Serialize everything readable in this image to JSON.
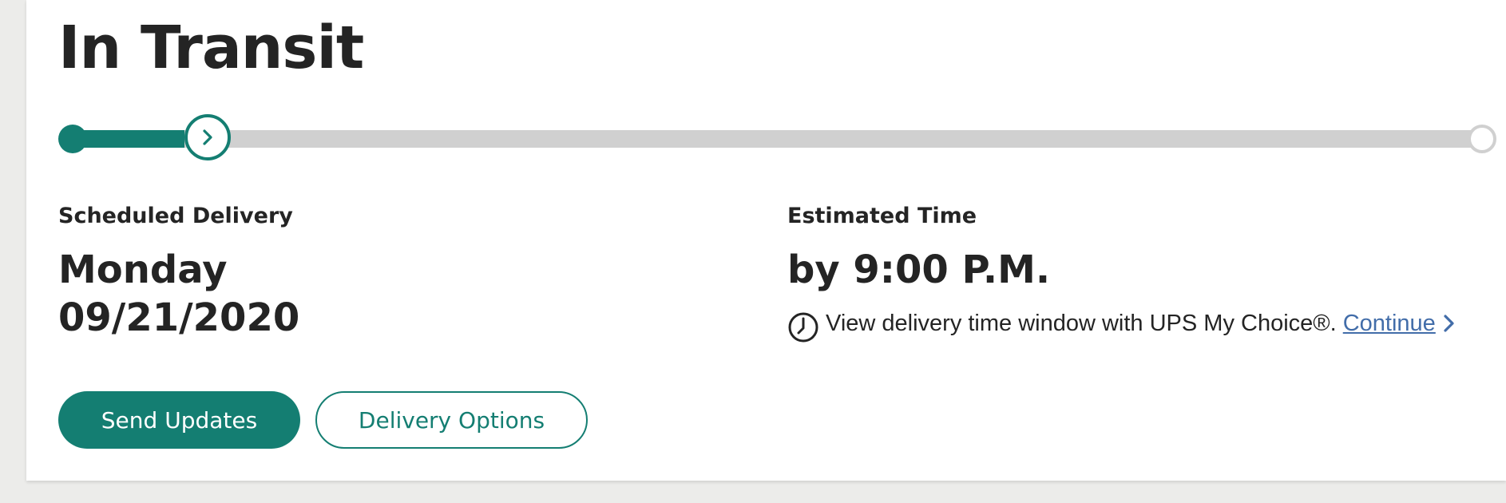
{
  "status": {
    "title": "In Transit"
  },
  "progress": {
    "current_step": 2,
    "total_steps": 3,
    "fill_fraction": 0.08,
    "colors": {
      "complete": "#147e72",
      "incomplete": "#d0d0d0"
    },
    "current_step_icon": "chevron-right-icon"
  },
  "scheduled_delivery": {
    "label": "Scheduled Delivery",
    "day": "Monday",
    "date": "09/21/2020"
  },
  "estimated_time": {
    "label": "Estimated Time",
    "value": "by 9:00 P.M.",
    "window_icon": "clock-icon",
    "window_text": "View delivery time window with UPS My Choice®.",
    "link_label": "Continue",
    "link_icon": "chevron-right-icon"
  },
  "actions": {
    "send_updates_label": "Send Updates",
    "delivery_options_label": "Delivery Options"
  },
  "theme": {
    "accent": "#147e72",
    "link": "#426da9",
    "text": "#242424"
  }
}
